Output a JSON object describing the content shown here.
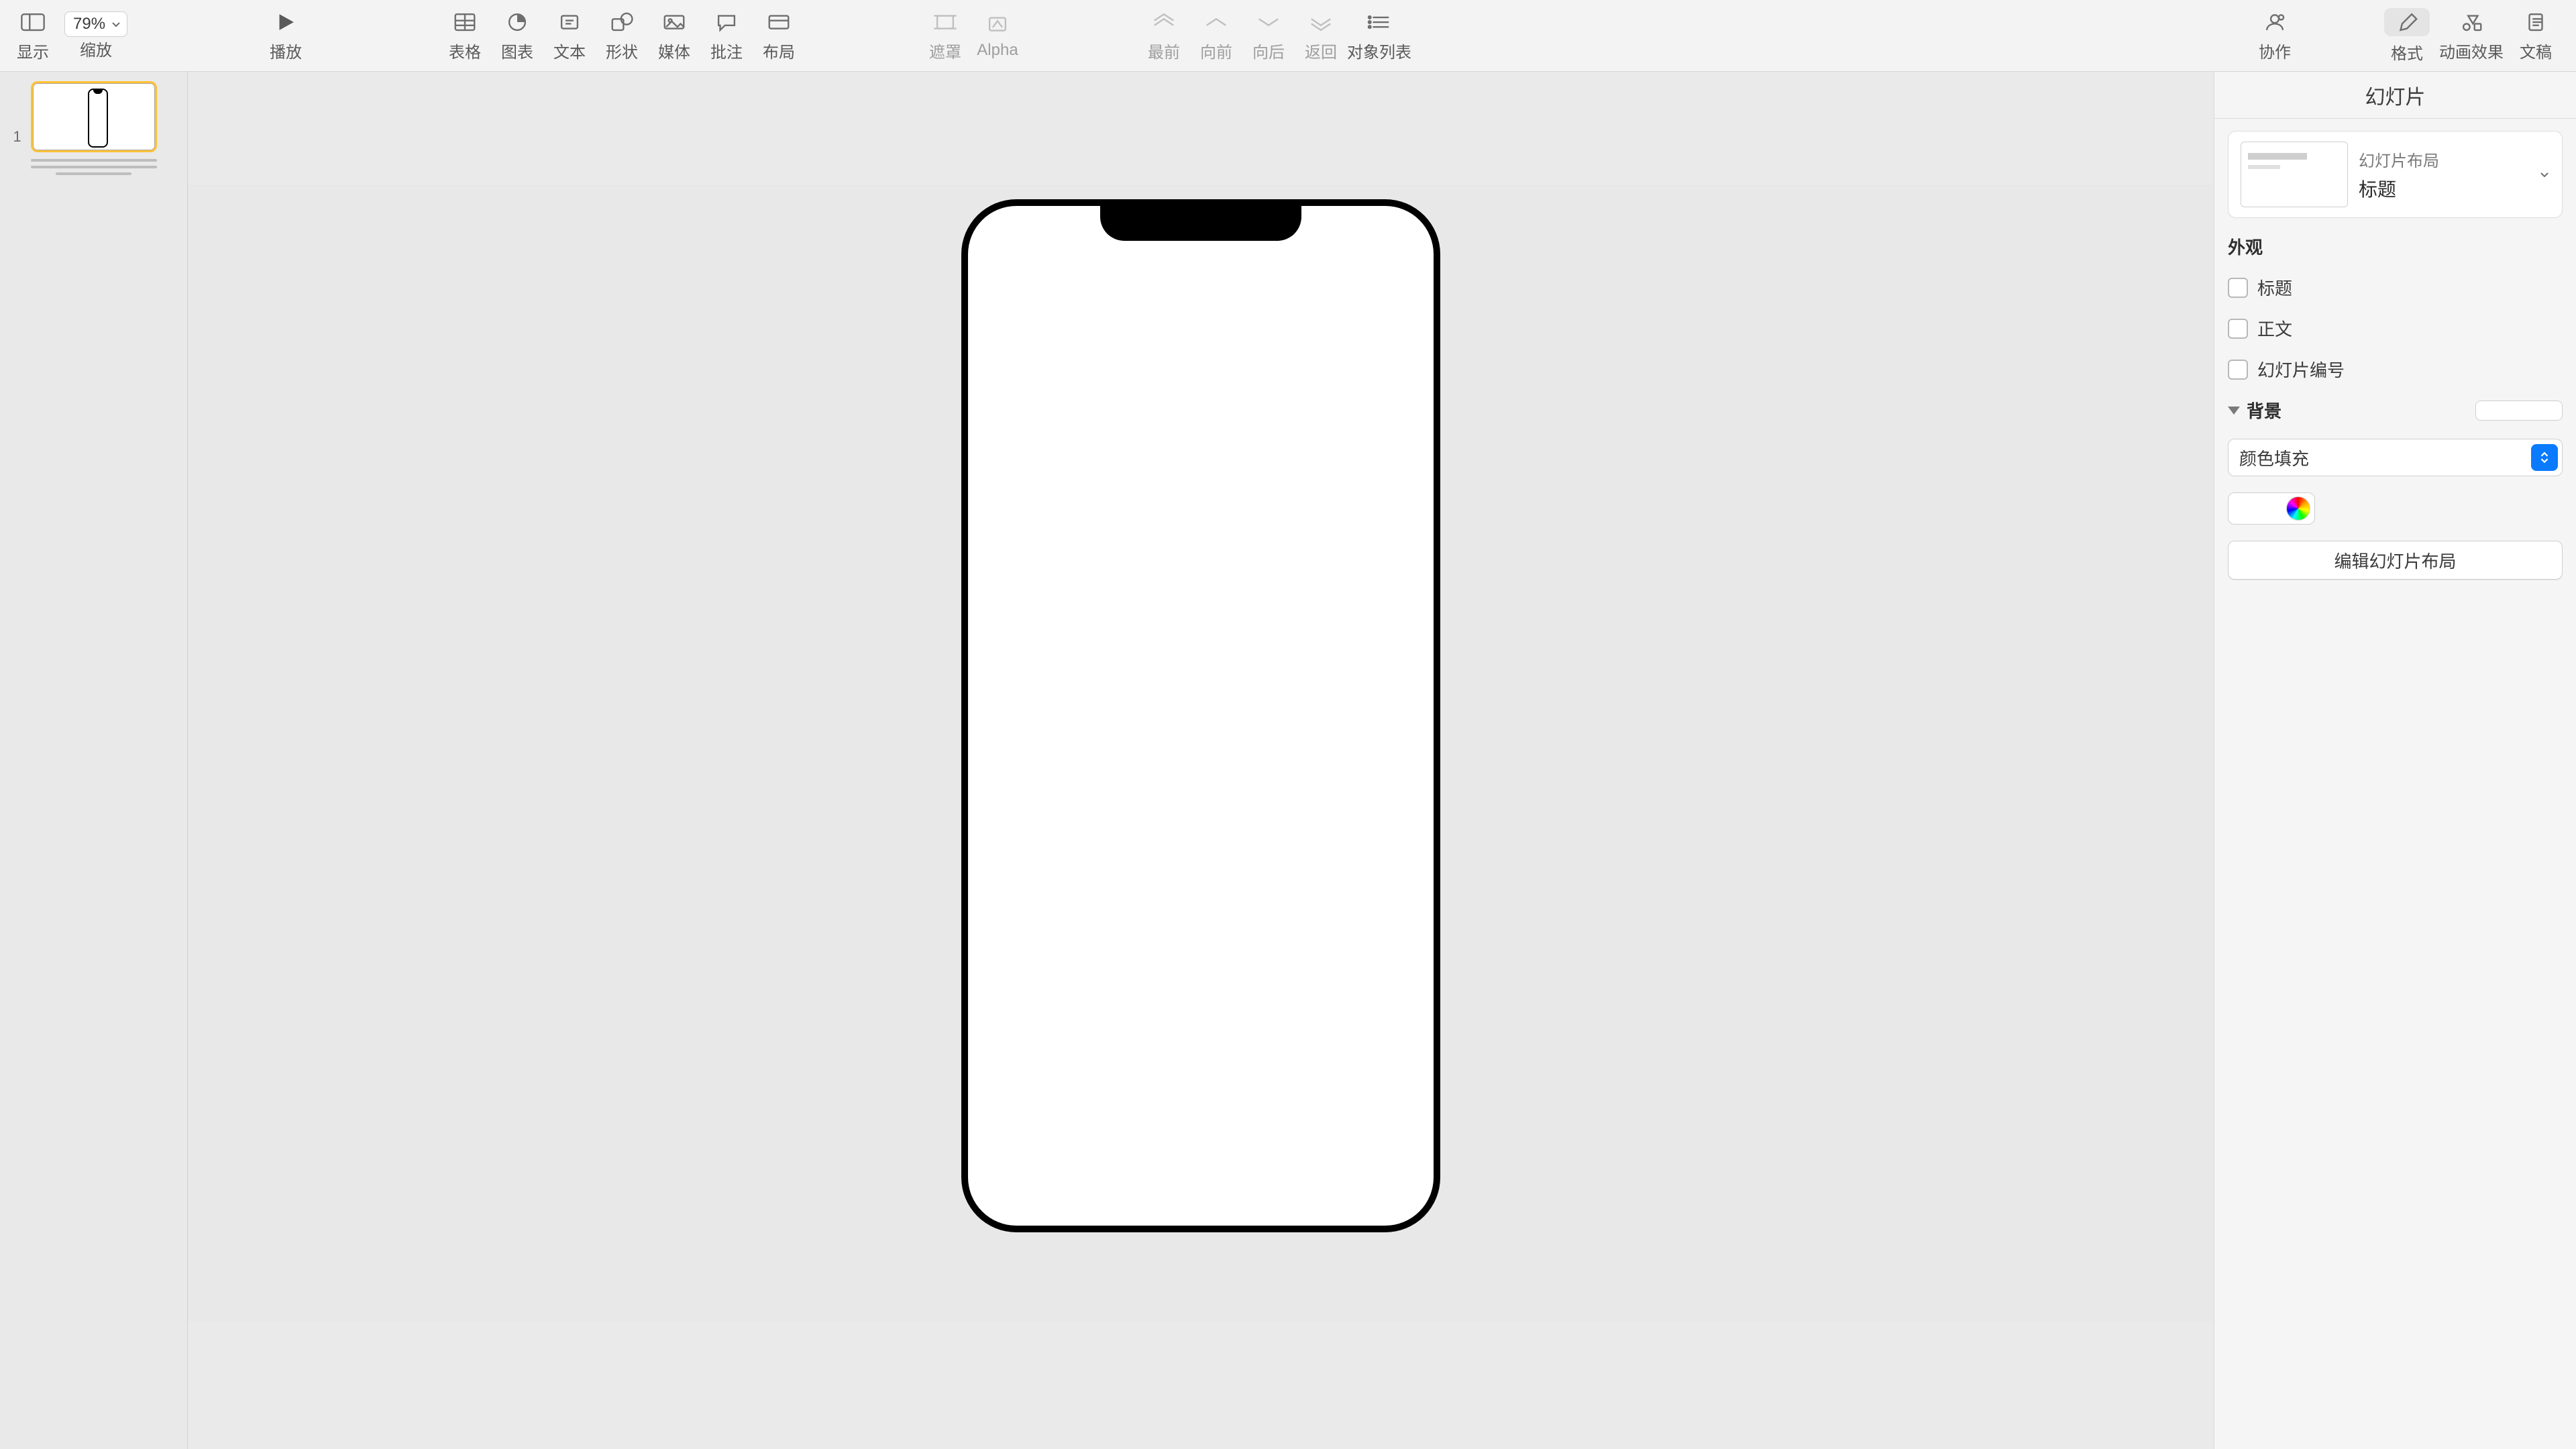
{
  "toolbar": {
    "view": {
      "label": "显示"
    },
    "zoom": {
      "label": "缩放",
      "value": "79%"
    },
    "play": {
      "label": "播放"
    },
    "table": {
      "label": "表格"
    },
    "chart": {
      "label": "图表"
    },
    "text": {
      "label": "文本"
    },
    "shape": {
      "label": "形状"
    },
    "media": {
      "label": "媒体"
    },
    "comment": {
      "label": "批注"
    },
    "layout": {
      "label": "布局"
    },
    "mask": {
      "label": "遮罩"
    },
    "alpha": {
      "label": "Alpha"
    },
    "front": {
      "label": "最前"
    },
    "forward": {
      "label": "向前"
    },
    "backward": {
      "label": "向后"
    },
    "back": {
      "label": "返回"
    },
    "objects": {
      "label": "对象列表"
    },
    "collab": {
      "label": "协作"
    },
    "format": {
      "label": "格式"
    },
    "animate": {
      "label": "动画效果"
    },
    "document": {
      "label": "文稿"
    }
  },
  "navigator": {
    "slides": [
      {
        "index": "1"
      }
    ]
  },
  "inspector": {
    "title": "幻灯片",
    "layoutCard": {
      "caption": "幻灯片布局",
      "name": "标题"
    },
    "appearance": {
      "section": "外观",
      "checks": {
        "title": "标题",
        "body": "正文",
        "number": "幻灯片编号"
      }
    },
    "background": {
      "section": "背景",
      "fillType": "颜色填充"
    },
    "editLayout": "编辑幻灯片布局"
  }
}
